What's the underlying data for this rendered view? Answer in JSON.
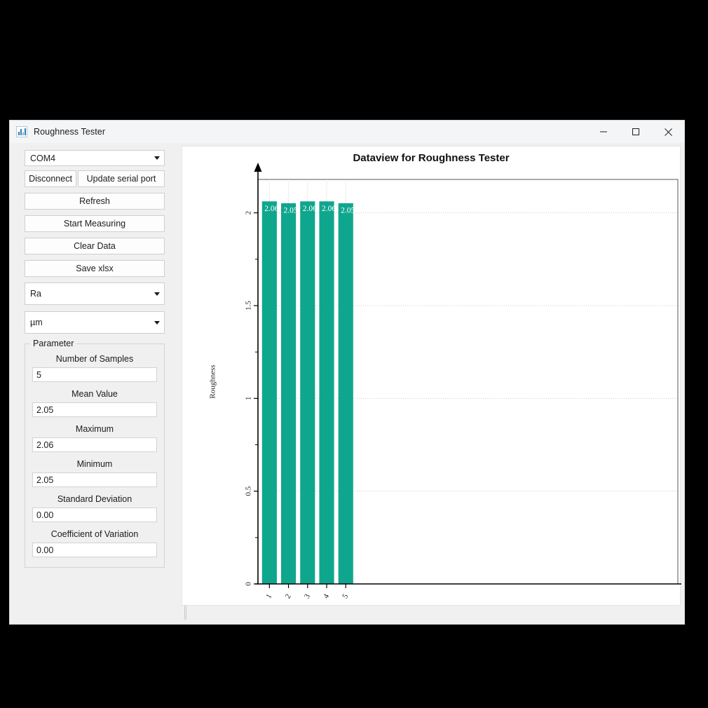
{
  "window": {
    "title": "Roughness Tester",
    "icon": "chart-icon",
    "controls": {
      "minimize": "minimize-icon",
      "maximize": "maximize-icon",
      "close": "close-icon"
    }
  },
  "sidebar": {
    "port_select": {
      "value": "COM4",
      "options": [
        "COM4"
      ]
    },
    "connect_button": "Disconnect",
    "update_port_button": "Update serial port",
    "actions": [
      "Refresh",
      "Start Measuring",
      "Clear Data",
      "Save xlsx"
    ],
    "parameter_select": {
      "value": "Ra",
      "options": [
        "Ra"
      ]
    },
    "unit_select": {
      "value": "µm",
      "options": [
        "µm"
      ]
    },
    "parameter_group": {
      "legend": "Parameter",
      "fields": [
        {
          "label": "Number of Samples",
          "value": "5"
        },
        {
          "label": "Mean Value",
          "value": "2.05"
        },
        {
          "label": "Maximum",
          "value": "2.06"
        },
        {
          "label": "Minimum",
          "value": "2.05"
        },
        {
          "label": "Standard Deviation",
          "value": "0.00"
        },
        {
          "label": "Coefficient of Variation",
          "value": "0.00"
        }
      ]
    }
  },
  "colors": {
    "bar": "#0fa68e",
    "bar_edge": "#0fa68e",
    "grid": "#cccccc",
    "axis": "#000000",
    "window_bg": "#f0f0f0",
    "plot_bg": "#ffffff"
  },
  "chart_data": {
    "type": "bar",
    "title": "Dataview for Roughness Tester",
    "xlabel": "",
    "ylabel": "Roughness",
    "categories": [
      "1",
      "2",
      "3",
      "4",
      "5"
    ],
    "values": [
      2.06,
      2.05,
      2.06,
      2.06,
      2.05
    ],
    "bar_labels": [
      "2.06",
      "2.05",
      "2.06",
      "2.06",
      "2.05"
    ],
    "yticks": [
      "0",
      "0.5",
      "1",
      "1.5",
      "2"
    ],
    "ytick_values": [
      0,
      0.5,
      1,
      1.5,
      2
    ],
    "ylim": [
      0,
      2.18
    ],
    "xlim": [
      0,
      22
    ],
    "grid": true,
    "legend": "none",
    "tick_label_rotation": 90
  }
}
